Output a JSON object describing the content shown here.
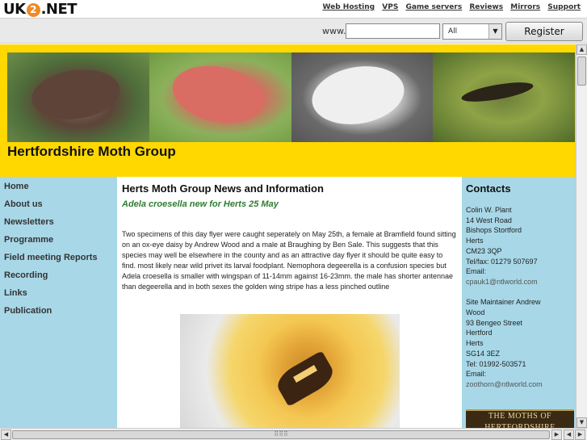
{
  "logo": {
    "pre": "UK",
    "mid": "2",
    "post": ".NET"
  },
  "top_links": [
    "Web Hosting",
    "VPS",
    "Game servers",
    "Reviews",
    "Mirrors",
    "Support"
  ],
  "register_bar": {
    "prefix": "www.",
    "domain_value": "",
    "select_value": "All",
    "button_label": "Register Domain"
  },
  "site": {
    "title": "Hertfordshire Moth Group",
    "nav": [
      "Home",
      "About us",
      "Newsletters",
      "Programme",
      "Field meeting Reports",
      "Recording",
      "Links",
      "Publication"
    ]
  },
  "main": {
    "heading": "Herts Moth Group News and Information",
    "news_title": "Adela croesella new for Herts 25 May",
    "news_body": "Two specimens of this day flyer were caught seperately on May 25th, a female at Bramfield found sitting on an ox-eye daisy by Andrew Wood and a male at Braughing by Ben Sale. This suggests that this species may well be elsewhere in the county and as an attractive day flyer it should be quite easy to find. most likely near wild privet its larval foodplant. Nemophora degeerella is a confusion species but Adela croesella is smaller with wingspan of 11-14mm against 16-23mm. the male has shorter antennae than degeerella and in both sexes the golden wing stripe has a less pinched outline"
  },
  "contacts": {
    "heading": "Contacts",
    "primary": {
      "name": "Colin W. Plant",
      "address": [
        "14 West Road",
        "Bishops Stortford",
        "Herts",
        "CM23 3QP"
      ],
      "phone": "Tel/fax: 01279 507697",
      "email_label": "Email:",
      "email": "cpauk1@ntlworld.com"
    },
    "maintainer": {
      "name_line1": "Site Maintainer Andrew",
      "name_line2": "Wood",
      "address": [
        "93 Bengeo Street",
        "Hertford",
        "Herts",
        "SG14 3EZ"
      ],
      "phone": "Tel: 01992-503571",
      "email_label": "Email:",
      "email": "zoothorn@ntlworld.com"
    },
    "book_text": "THE MOTHS OF HERTFORDSHIRE"
  },
  "icons": {
    "scroll_up": "▲",
    "scroll_down": "▼",
    "scroll_left": "◀",
    "scroll_right": "▶",
    "dropdown": "▼",
    "grip": "⠿⠿⠿"
  }
}
